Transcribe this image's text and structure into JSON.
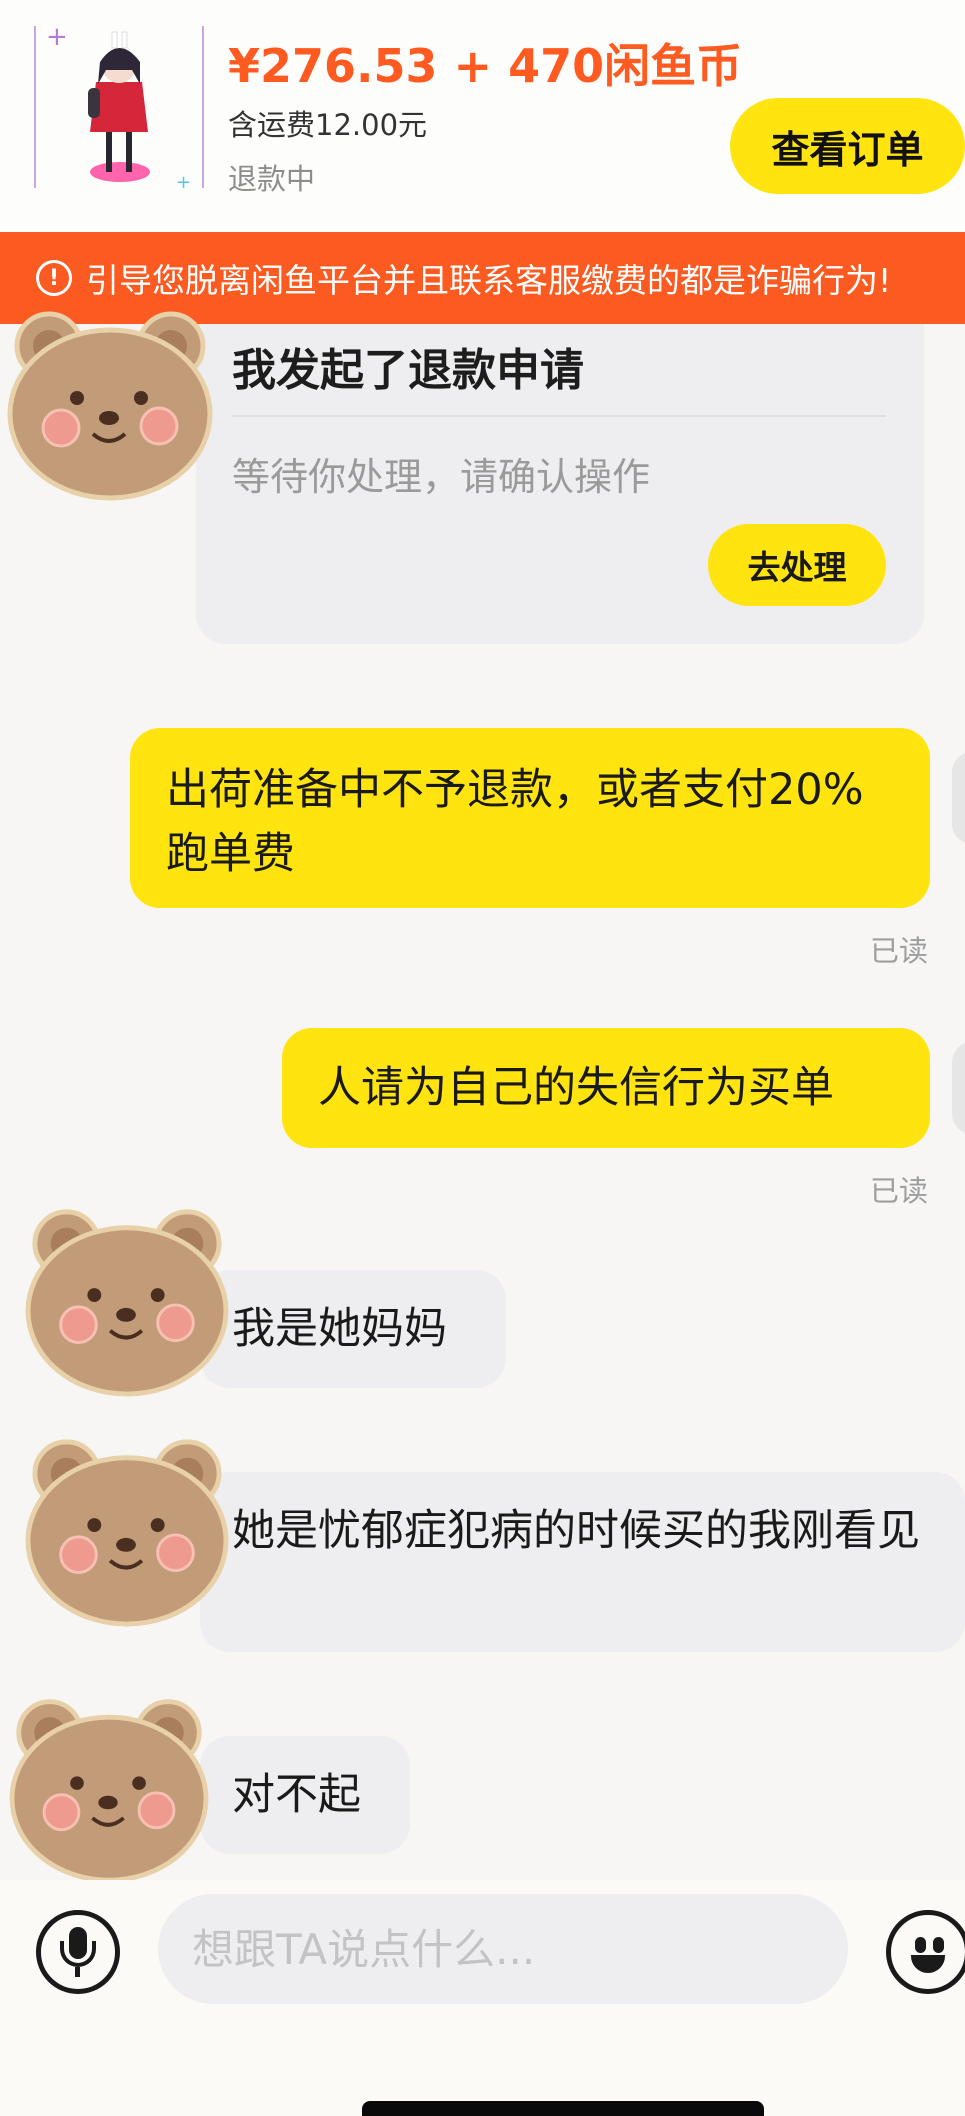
{
  "product": {
    "price": "¥276.53 + 470闲鱼币",
    "shipping": "含运费12.00元",
    "status": "退款中",
    "order_button": "查看订单"
  },
  "warning": {
    "icon": "exclamation-circle-icon",
    "text": "引导您脱离闲鱼平台并且联系客服缴费的都是诈骗行为!"
  },
  "refund_card": {
    "title": "我发起了退款申请",
    "subtitle": "等待你处理，请确认操作",
    "action_button": "去处理"
  },
  "messages": [
    {
      "from": "me",
      "text": "出荷准备中不予退款，或者支付20%跑单费",
      "read_label": "已读"
    },
    {
      "from": "me",
      "text": "人请为自己的失信行为买单",
      "read_label": "已读"
    },
    {
      "from": "buyer",
      "text": "我是她妈妈"
    },
    {
      "from": "buyer",
      "text": "她是忧郁症犯病的时候买的我刚看见"
    },
    {
      "from": "buyer",
      "text": "对不起"
    }
  ],
  "input": {
    "placeholder": "想跟TA说点什么...",
    "mic_icon": "microphone-icon",
    "emoji_icon": "smiley-icon"
  },
  "colors": {
    "accent_yellow": "#ffe40f",
    "price_orange": "#ff5a1f",
    "warning_orange": "#fb5a20",
    "bubble_gray": "#eeeef0"
  }
}
